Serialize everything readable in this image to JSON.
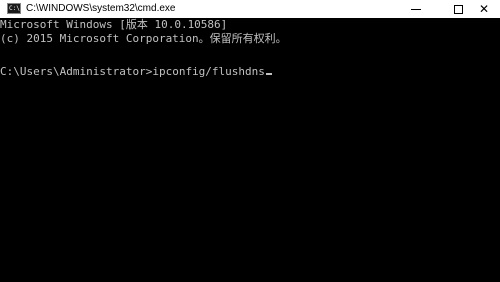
{
  "window": {
    "title": "C:\\WINDOWS\\system32\\cmd.exe",
    "icon": "cmd-icon",
    "icon_text": "C:\\",
    "controls": {
      "minimize": "minimize-icon",
      "maximize": "maximize-icon",
      "close": "close-icon",
      "close_glyph": "✕"
    }
  },
  "console": {
    "line1": "Microsoft Windows [版本 10.0.10586]",
    "line2": "(c) 2015 Microsoft Corporation。保留所有权利。",
    "prompt": "C:\\Users\\Administrator>",
    "command": "ipconfig/flushdns",
    "colors": {
      "background": "#000000",
      "text": "#c0c0c0"
    }
  }
}
